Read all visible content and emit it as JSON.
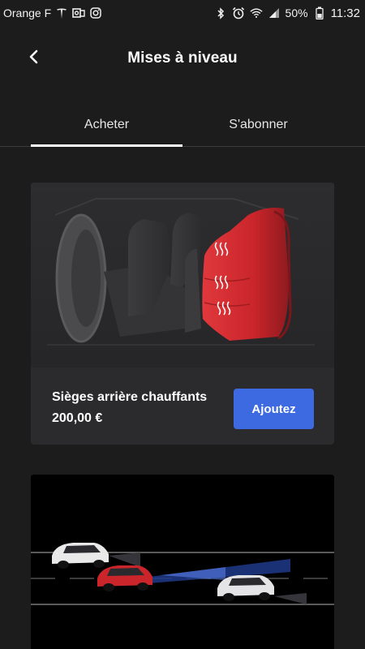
{
  "status_bar": {
    "carrier": "Orange F",
    "battery": "50%",
    "time": "11:32",
    "icons": [
      "tesla-icon",
      "outlook-icon",
      "instagram-icon",
      "bluetooth-icon",
      "alarm-icon",
      "wifi-icon",
      "signal-icon",
      "battery-icon"
    ]
  },
  "header": {
    "title": "Mises à niveau",
    "back_icon": "chevron-left-icon"
  },
  "tabs": [
    {
      "label": "Acheter",
      "active": true
    },
    {
      "label": "S'abonner",
      "active": false
    }
  ],
  "products": [
    {
      "name": "Sièges arrière chauffants",
      "price": "200,00 €",
      "button_label": "Ajoutez",
      "image": "heated-rear-seats-illustration"
    },
    {
      "image": "highway-cars-illustration"
    }
  ],
  "colors": {
    "background": "#1c1c1d",
    "card": "#2b2b2d",
    "accent_button": "#3e6ae1",
    "seat_red": "#c9252b"
  }
}
